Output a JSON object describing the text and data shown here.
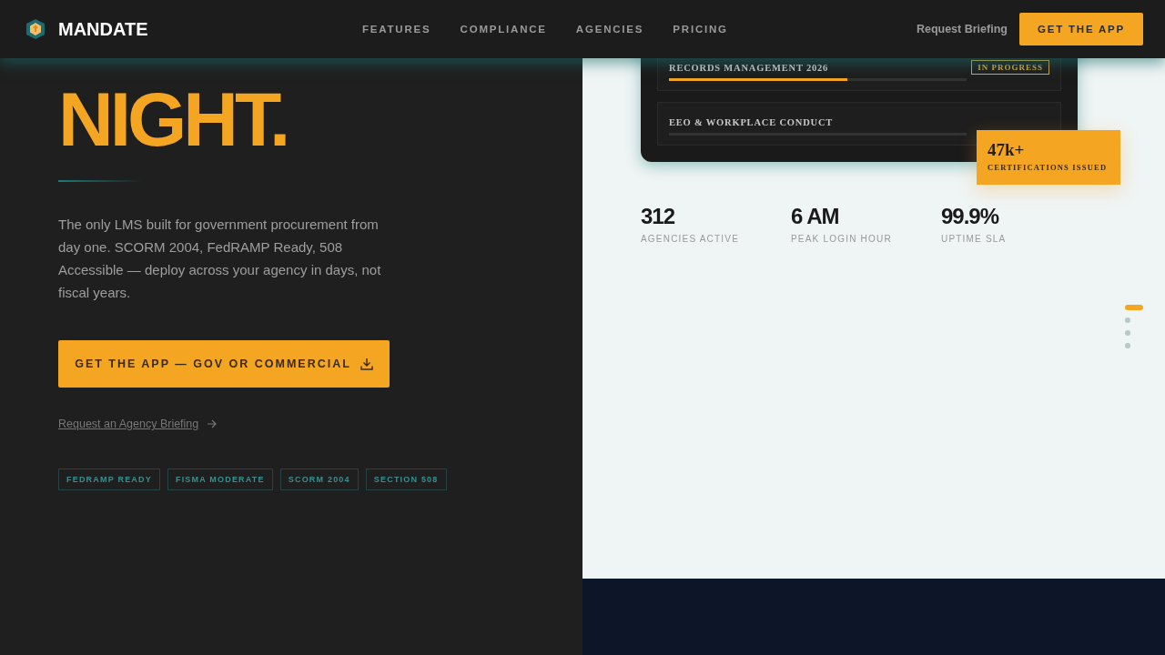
{
  "header": {
    "brand": "MANDATE",
    "nav": [
      {
        "label": "FEATURES"
      },
      {
        "label": "COMPLIANCE"
      },
      {
        "label": "AGENCIES"
      },
      {
        "label": "PRICING"
      }
    ],
    "secondary_link": "Request Briefing",
    "cta": "GET THE APP"
  },
  "hero": {
    "headline": [
      "NIGHT."
    ],
    "description": "The only LMS built for government procurement from day one. SCORM 2004, FedRAMP Ready, 508 Accessible — deploy across your agency in days, not fiscal years.",
    "primary_button": "GET THE APP — GOV OR COMMERCIAL",
    "secondary_link": "Request an Agency Briefing",
    "badges": [
      "FEDRAMP READY",
      "FISMA MODERATE",
      "SCORM 2004",
      "SECTION 508"
    ]
  },
  "dashboard": {
    "courses": [
      {
        "title": "RECORDS MANAGEMENT 2026",
        "status": "IN PROGRESS",
        "level": 0.6
      },
      {
        "title": "EEO & WORKPLACE CONDUCT"
      }
    ],
    "callout": {
      "value": "47k+",
      "label": "CERTIFICATIONS ISSUED"
    }
  },
  "stats": [
    {
      "value": "312",
      "label": "AGENCIES ACTIVE"
    },
    {
      "value": "6 AM",
      "label": "PEAK LOGIN HOUR"
    },
    {
      "value": "99.9%",
      "label": "UPTIME SLA"
    }
  ],
  "pager": [
    {
      "selected": true
    },
    {
      "selected": false
    },
    {
      "selected": false
    },
    {
      "selected": false
    }
  ]
}
